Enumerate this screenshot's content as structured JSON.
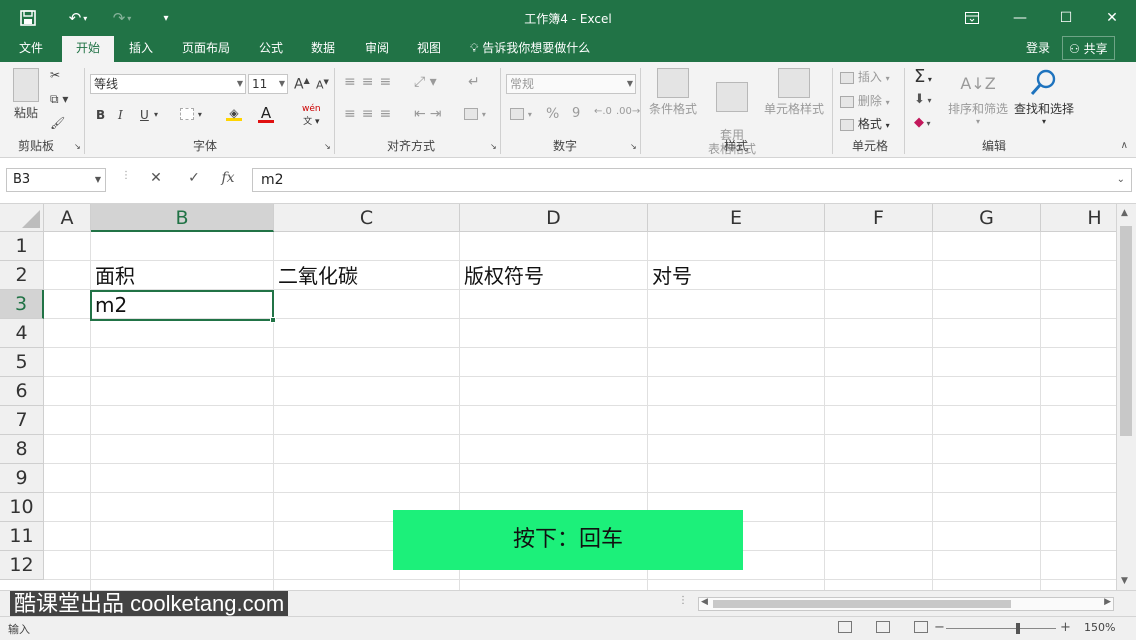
{
  "app": {
    "title": "工作簿4 - Excel"
  },
  "qat": {
    "save_icon": "save-icon",
    "undo_icon": "undo-icon",
    "redo_icon": "redo-icon",
    "customize_icon": "customize-qat-icon"
  },
  "tabs": [
    {
      "label": "文件",
      "active": false
    },
    {
      "label": "开始",
      "active": true
    },
    {
      "label": "插入",
      "active": false
    },
    {
      "label": "页面布局",
      "active": false
    },
    {
      "label": "公式",
      "active": false
    },
    {
      "label": "数据",
      "active": false
    },
    {
      "label": "审阅",
      "active": false
    },
    {
      "label": "视图",
      "active": false
    }
  ],
  "tellme": "告诉我你想要做什么",
  "login": "登录",
  "share": "共享",
  "ribbon": {
    "clipboard": {
      "paste": "粘贴",
      "label": "剪贴板"
    },
    "font": {
      "name": "等线",
      "size": "11",
      "label": "字体",
      "bold": "B",
      "italic": "I",
      "underline": "U",
      "grow": "A",
      "shrink": "A",
      "phonetic": "wén"
    },
    "alignment": {
      "label": "对齐方式"
    },
    "number": {
      "format": "常规",
      "label": "数字",
      "percent": "%",
      "comma": "9"
    },
    "styles": {
      "conditional": "条件格式",
      "table": "套用\n表格格式",
      "cell": "单元格样式",
      "label": "样式"
    },
    "cells": {
      "insert": "插入",
      "delete": "删除",
      "format": "格式",
      "label": "单元格"
    },
    "editing": {
      "sum": "Σ",
      "sort": "排序和筛选",
      "find": "查找和选择",
      "label": "编辑"
    }
  },
  "formula_bar": {
    "name_box": "B3",
    "cancel": "✕",
    "enter": "✓",
    "fx": "fx",
    "value": "m2"
  },
  "grid": {
    "columns": [
      "A",
      "B",
      "C",
      "D",
      "E",
      "F",
      "G",
      "H"
    ],
    "selected_column": "B",
    "rows": [
      "1",
      "2",
      "3",
      "4",
      "5",
      "6",
      "7",
      "8",
      "9",
      "10",
      "11",
      "12"
    ],
    "selected_row": "3",
    "cells": {
      "B2": "面积",
      "C2": "二氧化碳",
      "D2": "版权符号",
      "E2": "对号",
      "B3": "m2"
    }
  },
  "overlay": "按下：回车",
  "watermark": "酷课堂出品 coolketang.com",
  "status": {
    "mode": "输入",
    "zoom_minus": "−",
    "zoom_plus": "+",
    "zoom": "150%"
  }
}
